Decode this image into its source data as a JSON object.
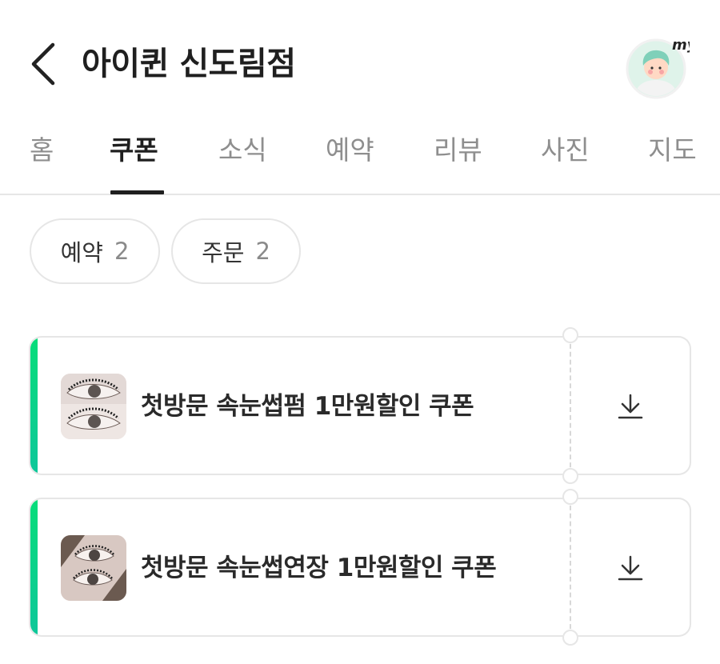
{
  "header": {
    "title": "아이퀸 신도림점",
    "avatar_badge": "my"
  },
  "tabs": [
    {
      "label": "홈",
      "active": false
    },
    {
      "label": "쿠폰",
      "active": true
    },
    {
      "label": "소식",
      "active": false
    },
    {
      "label": "예약",
      "active": false
    },
    {
      "label": "리뷰",
      "active": false
    },
    {
      "label": "사진",
      "active": false
    },
    {
      "label": "지도",
      "active": false
    }
  ],
  "filters": [
    {
      "label": "예약",
      "count": "2"
    },
    {
      "label": "주문",
      "count": "2"
    }
  ],
  "coupons": [
    {
      "title": "첫방문 속눈썹펌 1만원할인 쿠폰",
      "icon": "download-icon"
    },
    {
      "title": "첫방문 속눈썹연장 1만원할인 쿠폰",
      "icon": "download-icon"
    }
  ],
  "colors": {
    "accent_green": "#08dd7a",
    "text_primary": "#1f1f1f",
    "text_muted": "#8e8e8e",
    "border": "#e6e6e6"
  }
}
